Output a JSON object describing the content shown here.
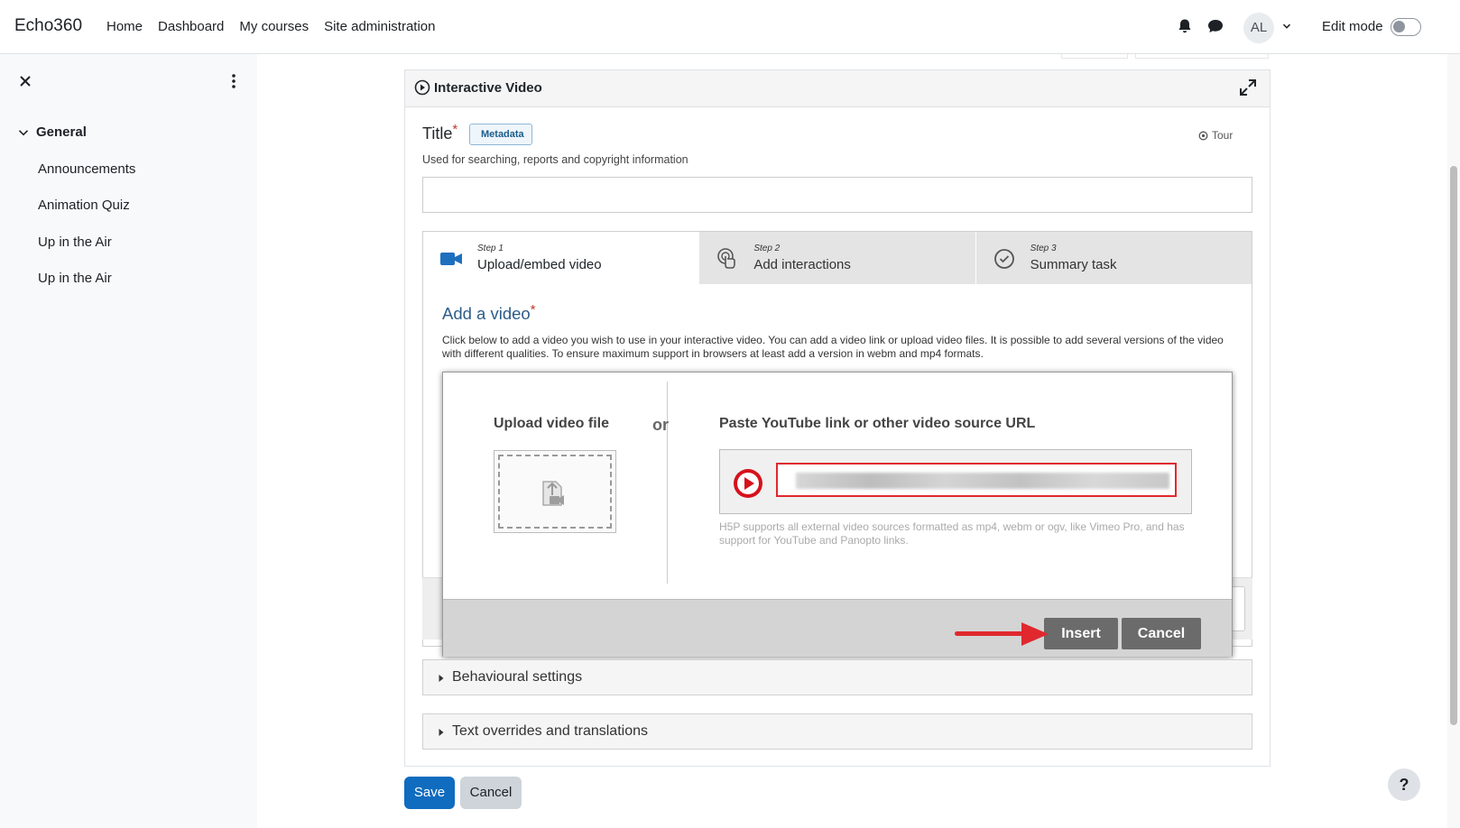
{
  "topbar": {
    "brand": "Echo360",
    "nav": [
      "Home",
      "Dashboard",
      "My courses",
      "Site administration"
    ],
    "avatar_initials": "AL",
    "edit_mode_label": "Edit mode"
  },
  "sidebar": {
    "section_label": "General",
    "items": [
      {
        "label": "Announcements"
      },
      {
        "label": "Animation Quiz"
      },
      {
        "label": "Up in the Air"
      },
      {
        "label": "Up in the Air"
      }
    ]
  },
  "editor": {
    "header_title": "Interactive Video",
    "title_label": "Title",
    "required_mark": "*",
    "metadata_label": "Metadata",
    "tour_label": "Tour",
    "title_description": "Used for searching, reports and copyright information",
    "title_value": "",
    "steps": [
      {
        "num": "Step 1",
        "label": "Upload/embed video",
        "icon": "video-camera-icon",
        "active": true
      },
      {
        "num": "Step 2",
        "label": "Add interactions",
        "icon": "touch-interaction-icon",
        "active": false
      },
      {
        "num": "Step 3",
        "label": "Summary task",
        "icon": "check-circle-icon",
        "active": false
      }
    ],
    "add_video_title": "Add a video",
    "add_video_description": "Click below to add a video you wish to use in your interactive video. You can add a video link or upload video files. It is possible to add several versions of the video with different qualities. To ensure maximum support in browsers at least add a version in webm and mp4 formats."
  },
  "dialog": {
    "upload_title": "Upload video file",
    "or_label": "or",
    "paste_title": "Paste YouTube link or other video source URL",
    "url_hint": "H5P supports all external video sources formatted as mp4, webm or ogv, like Vimeo Pro, and has support for YouTube and Panopto links.",
    "insert_label": "Insert",
    "cancel_label": "Cancel"
  },
  "accordions": [
    {
      "label": "Behavioural settings"
    },
    {
      "label": "Text overrides and translations"
    }
  ],
  "form_buttons": {
    "save_label": "Save",
    "cancel_label": "Cancel"
  },
  "help_label": "?",
  "colors": {
    "primary": "#0f6cbf",
    "required": "#c0392b",
    "highlight": "#e0282e",
    "add_video_title": "#2d5c8a"
  }
}
